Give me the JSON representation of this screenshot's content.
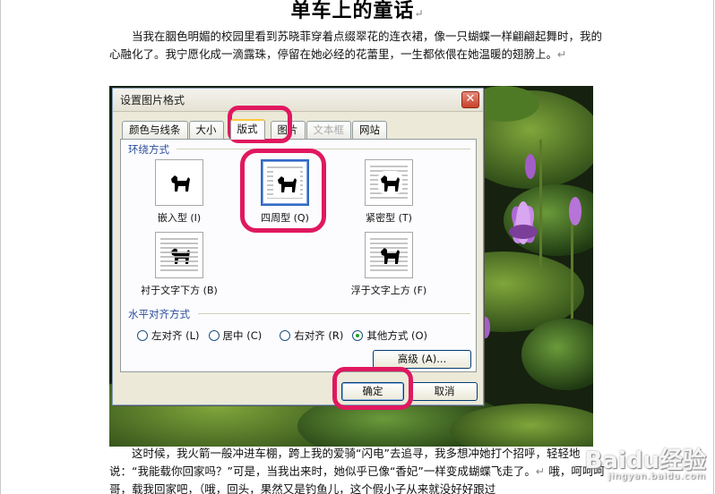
{
  "document": {
    "title": "单车上的童话",
    "title_mark": "↵",
    "paragraph1": "当我在胭色明媚的校园里看到苏晓菲穿着点缀翠花的连衣裙，像一只蝴蝶一样翩翩起舞时，我的心融化了。我宁愿化成一滴露珠，停留在她必经的花蕾里，一生都依偎在她温暖的翅膀上。",
    "paragraph1_mark": "↵",
    "paragraph2": "这时候，我火箭一般冲进车棚，跨上我的爱骑“闪电”去追寻，我多想冲她打个招呼，轻轻地说：“我能载你回家吗？”可是，当我出来时，她似乎已像“香妃”一样变成蝴蝶飞走了。",
    "paragraph2_mark": "↵",
    "paragraph3_partial": "哦，呵呵呵哥，载我回家吧，（哦，回头，果然又是钓鱼儿，这个假小子从来就没好好跟过"
  },
  "dialog": {
    "title": "设置图片格式",
    "close_glyph": "✕",
    "tabs": [
      {
        "label": "颜色与线条",
        "state": "normal"
      },
      {
        "label": "大小",
        "state": "normal"
      },
      {
        "label": "版式",
        "state": "active"
      },
      {
        "label": "图片",
        "state": "normal"
      },
      {
        "label": "文本框",
        "state": "disabled"
      },
      {
        "label": "网站",
        "state": "normal"
      }
    ],
    "wrap_section_label": "环绕方式",
    "wrap_options": [
      {
        "label": "嵌入型 (I)",
        "icon": "wrap-inline-icon",
        "selected": false
      },
      {
        "label": "四周型 (Q)",
        "icon": "wrap-square-icon",
        "selected": true
      },
      {
        "label": "紧密型 (T)",
        "icon": "wrap-tight-icon",
        "selected": false
      },
      {
        "label": "衬于文字下方 (B)",
        "icon": "wrap-behind-text-icon",
        "selected": false
      },
      {
        "label": "浮于文字上方 (F)",
        "icon": "wrap-in-front-of-text-icon",
        "selected": false
      }
    ],
    "align_section_label": "水平对齐方式",
    "align_options": [
      {
        "label": "左对齐 (L)",
        "checked": false
      },
      {
        "label": "居中 (C)",
        "checked": false
      },
      {
        "label": "右对齐 (R)",
        "checked": false
      },
      {
        "label": "其他方式 (O)",
        "checked": true
      }
    ],
    "advanced_button": "高级 (A)...",
    "ok_button": "确定",
    "cancel_button": "取消"
  },
  "highlight_color": "#e0185f",
  "watermark": {
    "text": "Baidu经验",
    "sub": "jingyan.baidu.com"
  }
}
